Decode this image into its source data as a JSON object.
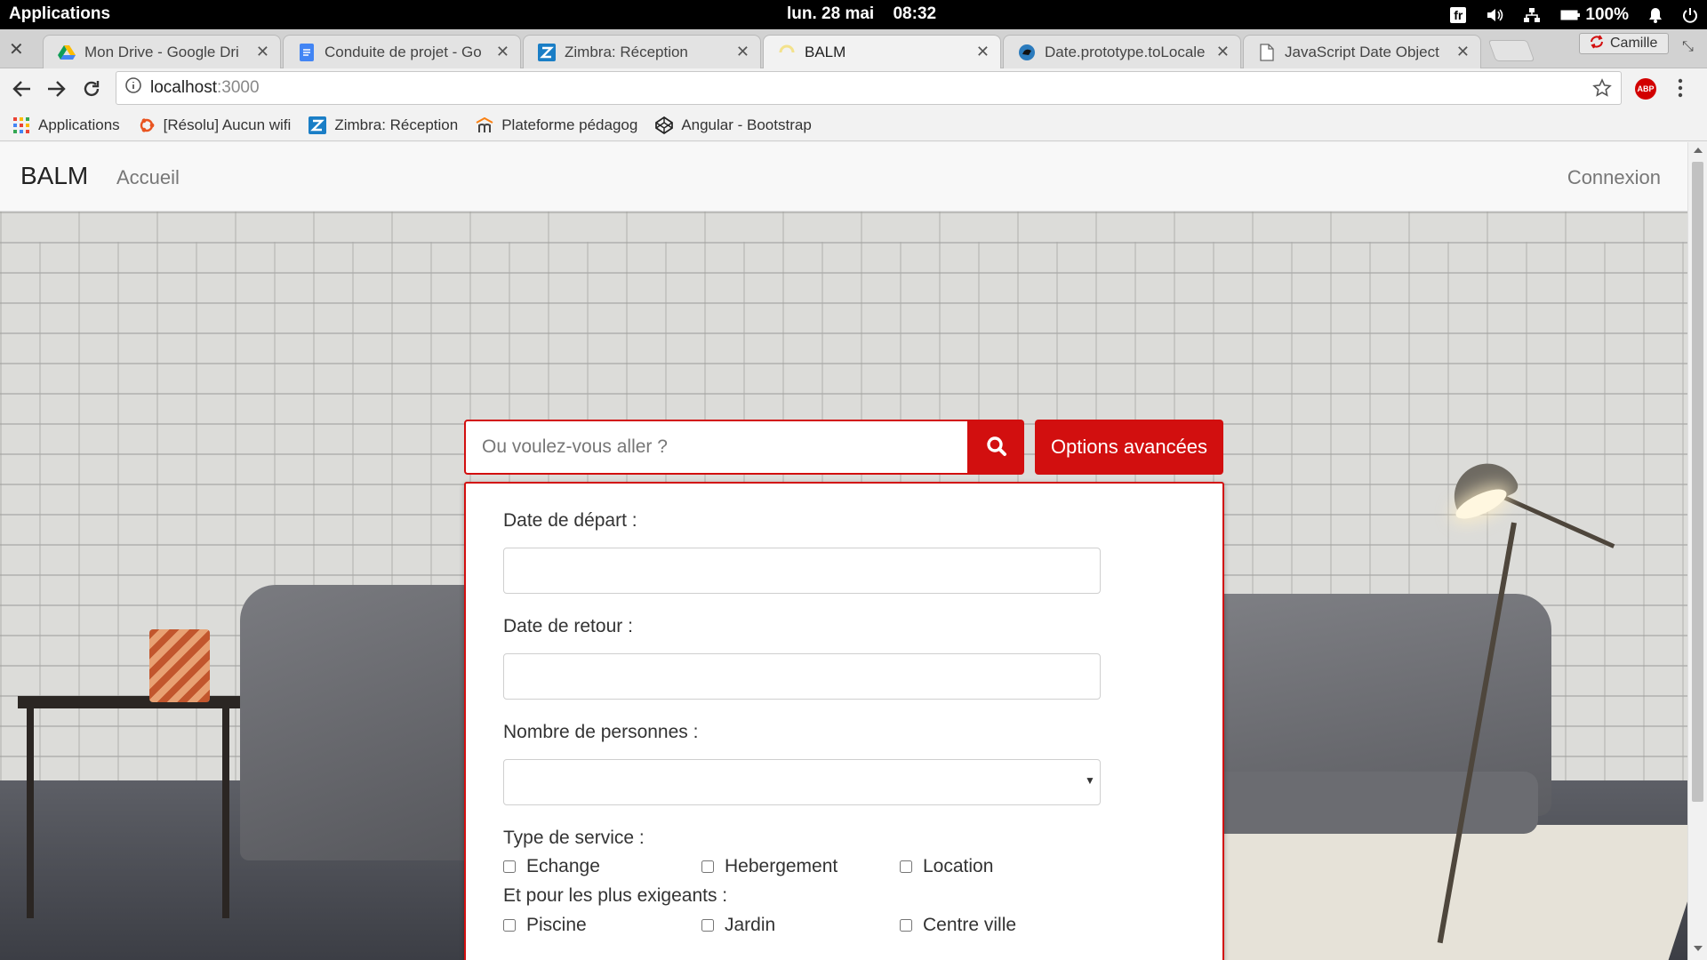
{
  "os": {
    "apps_label": "Applications",
    "date": "lun. 28 mai",
    "time": "08:32",
    "lang": "fr",
    "battery": "100%"
  },
  "browser": {
    "tabs": [
      {
        "title": "Mon Drive - Google Dri",
        "icon": "google-drive-icon"
      },
      {
        "title": "Conduite de projet - Go",
        "icon": "google-docs-icon"
      },
      {
        "title": "Zimbra: Réception",
        "icon": "zimbra-icon"
      },
      {
        "title": "BALM",
        "icon": "loading-icon",
        "active": true
      },
      {
        "title": "Date.prototype.toLocale",
        "icon": "mdn-icon"
      },
      {
        "title": "JavaScript Date Object",
        "icon": "page-icon"
      }
    ],
    "profile_name": "Camille",
    "url_host": "localhost",
    "url_port": ":3000",
    "abp_label": "ABP",
    "bookmarks": [
      {
        "label": "Applications",
        "icon": "apps-grid-icon"
      },
      {
        "label": "[Résolu] Aucun wifi",
        "icon": "ubuntu-icon"
      },
      {
        "label": "Zimbra: Réception",
        "icon": "zimbra-icon"
      },
      {
        "label": "Plateforme pédagog",
        "icon": "moodle-icon"
      },
      {
        "label": "Angular - Bootstrap",
        "icon": "codepen-icon"
      }
    ]
  },
  "site": {
    "brand": "BALM",
    "nav_home": "Accueil",
    "login": "Connexion",
    "search_placeholder": "Ou voulez-vous aller ?",
    "advanced_label": "Options avancées",
    "accent": "#d20f0f"
  },
  "form": {
    "departure_label": "Date de départ :",
    "departure_value": "",
    "return_label": "Date de retour :",
    "return_value": "",
    "people_label": "Nombre de personnes :",
    "people_value": "",
    "service_label": "Type de service :",
    "services": [
      "Echange",
      "Hebergement",
      "Location"
    ],
    "extras_label": "Et pour les plus exigeants :",
    "extras": [
      "Piscine",
      "Jardin",
      "Centre ville"
    ]
  }
}
